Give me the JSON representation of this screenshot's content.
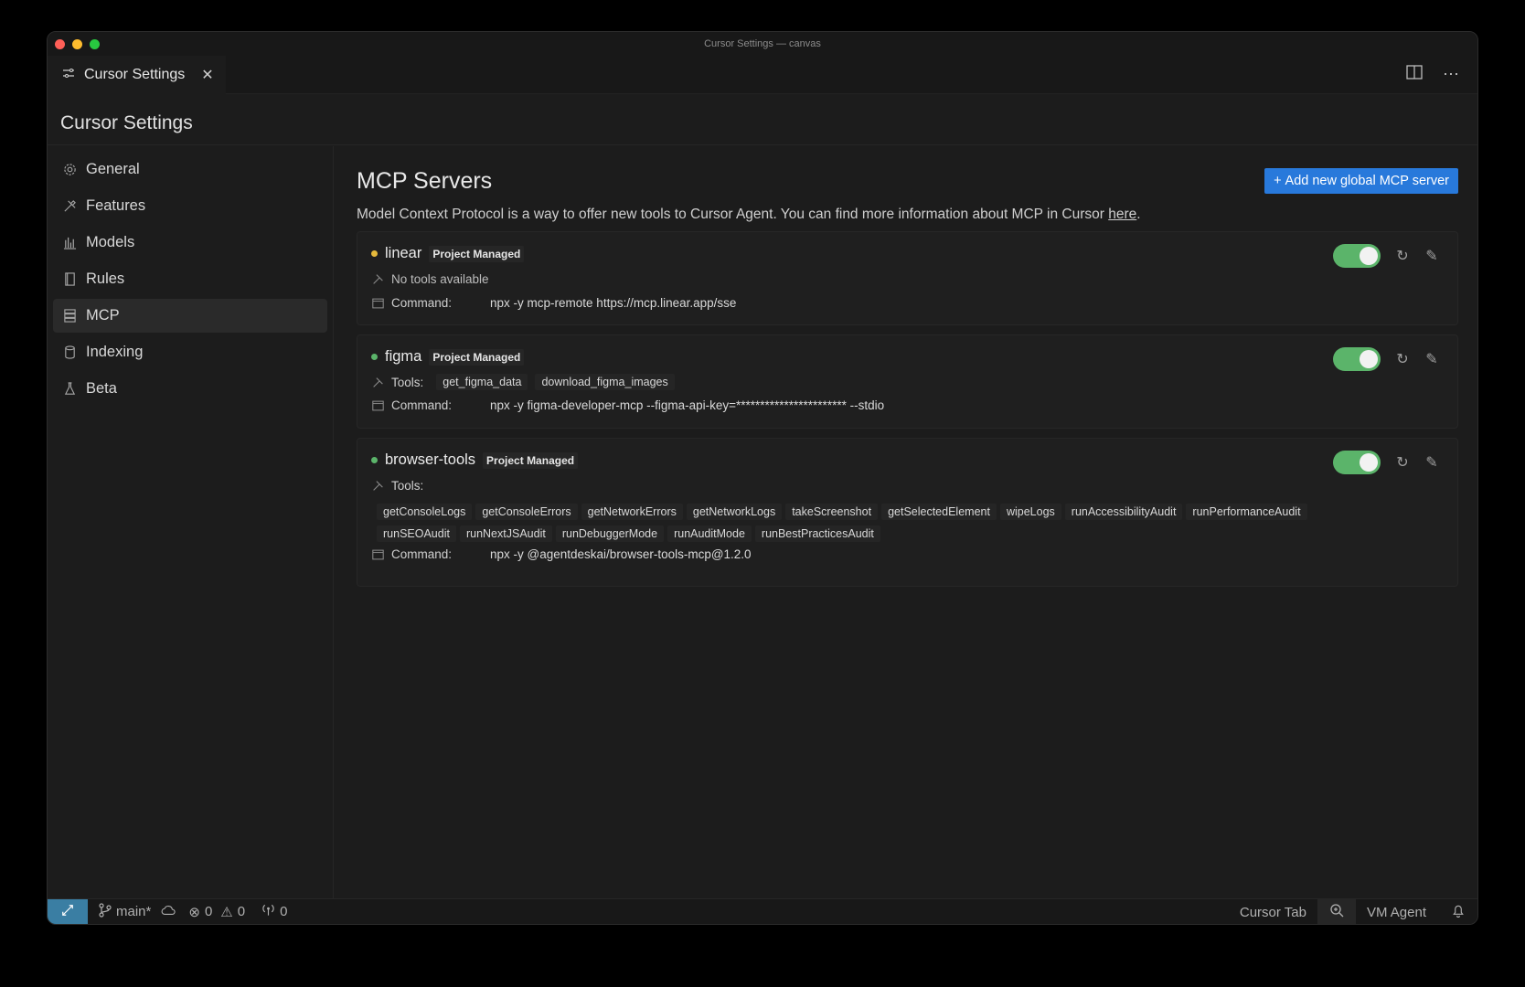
{
  "window": {
    "title": "Cursor Settings — canvas"
  },
  "tab": {
    "label": "Cursor Settings"
  },
  "header": {
    "title": "Cursor Settings"
  },
  "sidebar": {
    "items": [
      {
        "label": "General",
        "icon": "gear-icon"
      },
      {
        "label": "Features",
        "icon": "tools-icon"
      },
      {
        "label": "Models",
        "icon": "bar-chart-icon"
      },
      {
        "label": "Rules",
        "icon": "book-icon"
      },
      {
        "label": "MCP",
        "icon": "server-icon",
        "active": true
      },
      {
        "label": "Indexing",
        "icon": "database-icon"
      },
      {
        "label": "Beta",
        "icon": "flask-icon"
      }
    ]
  },
  "main": {
    "title": "MCP Servers",
    "add_button": "Add new global MCP server",
    "description": "Model Context Protocol is a way to offer new tools to Cursor Agent. You can find more information about MCP in Cursor ",
    "description_link": "here",
    "description_end": "."
  },
  "servers": [
    {
      "name": "linear",
      "badge": "Project Managed",
      "status_color": "#e5b93b",
      "tools_text": "No tools available",
      "command_label": "Command:",
      "command": "npx -y mcp-remote https://mcp.linear.app/sse",
      "enabled": true
    },
    {
      "name": "figma",
      "badge": "Project Managed",
      "status_color": "#5bb46a",
      "tools_label": "Tools:",
      "tools": [
        "get_figma_data",
        "download_figma_images"
      ],
      "command_label": "Command:",
      "command": "npx -y figma-developer-mcp --figma-api-key=*********************** --stdio",
      "enabled": true
    },
    {
      "name": "browser-tools",
      "badge": "Project Managed",
      "status_color": "#5bb46a",
      "tools_label": "Tools:",
      "tools": [
        "getConsoleLogs",
        "getConsoleErrors",
        "getNetworkErrors",
        "getNetworkLogs",
        "takeScreenshot",
        "getSelectedElement",
        "wipeLogs",
        "runAccessibilityAudit",
        "runPerformanceAudit",
        "runSEOAudit",
        "runNextJSAudit",
        "runDebuggerMode",
        "runAuditMode",
        "runBestPracticesAudit"
      ],
      "command_label": "Command:",
      "command": "npx -y @agentdeskai/browser-tools-mcp@1.2.0",
      "enabled": true
    }
  ],
  "statusbar": {
    "branch": "main*",
    "errors": "0",
    "warnings": "0",
    "ports": "0",
    "cursor_tab": "Cursor Tab",
    "vm_agent": "VM Agent"
  }
}
